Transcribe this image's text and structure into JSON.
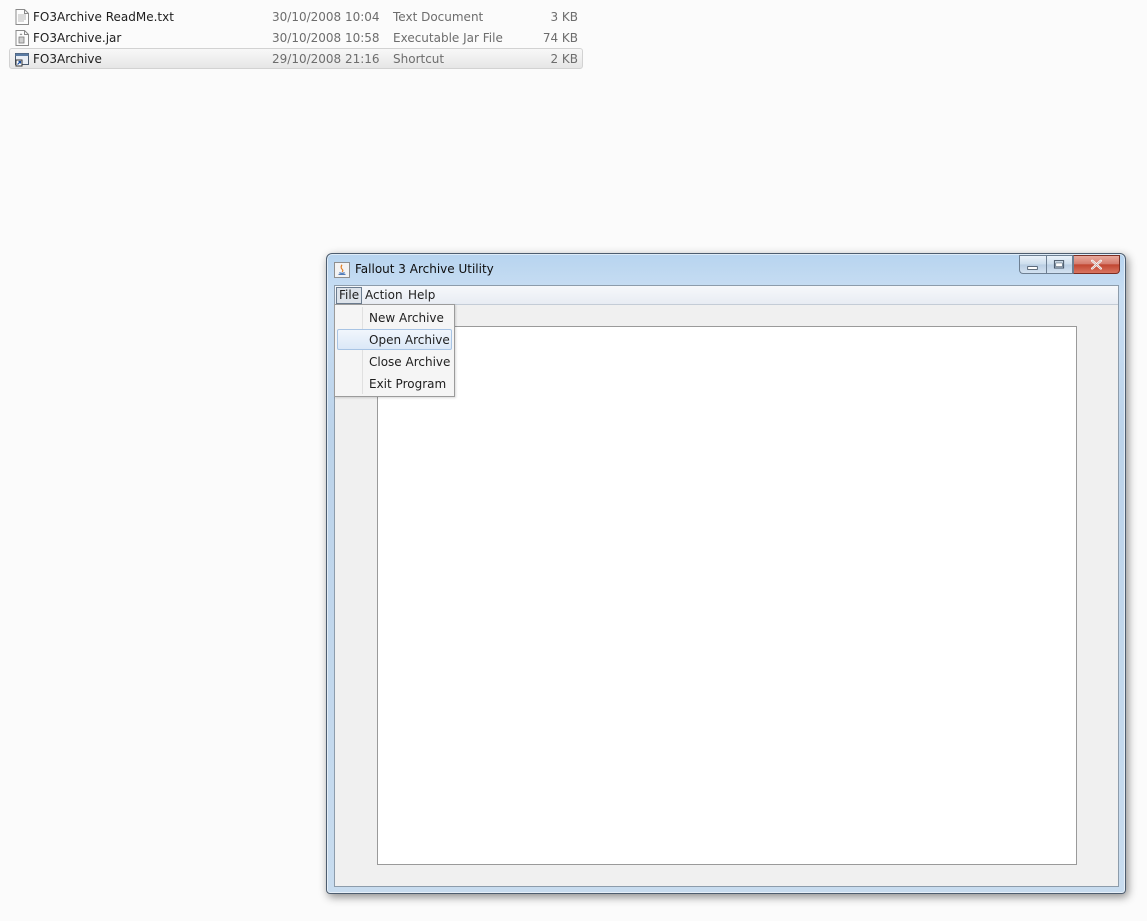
{
  "explorer": {
    "files": [
      {
        "name": "FO3Archive ReadMe.txt",
        "date": "30/10/2008 10:04",
        "type": "Text Document",
        "size": "3 KB",
        "icon": "text-file-icon",
        "selected": false
      },
      {
        "name": "FO3Archive.jar",
        "date": "30/10/2008 10:58",
        "type": "Executable Jar File",
        "size": "74 KB",
        "icon": "jar-file-icon",
        "selected": false
      },
      {
        "name": "FO3Archive",
        "date": "29/10/2008 21:16",
        "type": "Shortcut",
        "size": "2 KB",
        "icon": "shortcut-icon",
        "selected": true
      }
    ]
  },
  "window": {
    "title": "Fallout 3 Archive Utility",
    "icon": "java-app-icon",
    "caption_buttons": [
      "minimize-icon",
      "maximize-icon",
      "close-icon"
    ]
  },
  "menubar": {
    "items": [
      {
        "label": "File",
        "active": true
      },
      {
        "label": "Action",
        "active": false
      },
      {
        "label": "Help",
        "active": false
      }
    ]
  },
  "file_menu": {
    "items": [
      {
        "label": "New Archive",
        "highlighted": false
      },
      {
        "label": "Open Archive",
        "highlighted": true
      },
      {
        "label": "Close Archive",
        "highlighted": false
      },
      {
        "label": "Exit Program",
        "highlighted": false
      }
    ]
  },
  "colors": {
    "menu_highlight": "#dbe8f7",
    "title_bar": "#b7d4ef",
    "close_button": "#c0442f"
  }
}
